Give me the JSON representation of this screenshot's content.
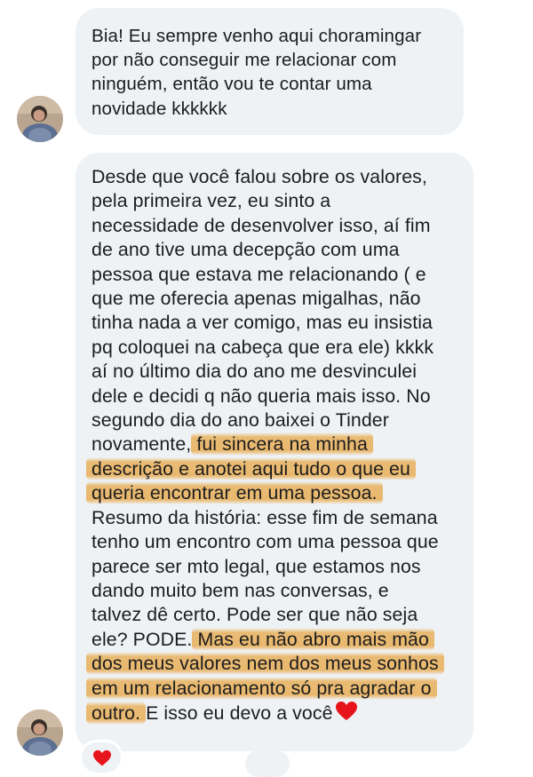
{
  "messages": [
    {
      "lines": [
        "Bia! Eu sempre venho aqui choramingar",
        "por não conseguir me relacionar com",
        "ninguém, então vou te contar uma",
        "novidade kkkkkk"
      ]
    },
    {
      "lines": [
        "Desde que você falou sobre os valores,",
        "pela primeira vez, eu sinto a",
        "necessidade de desenvolver isso, aí fim",
        "de ano tive uma decepção com uma",
        "pessoa que estava me relacionando ( e",
        "que me oferecia apenas migalhas, não",
        "tinha nada a ver comigo, mas eu insistia",
        "pq coloquei na cabeça que era ele) kkkk",
        "aí no último dia do ano me desvinculei",
        "dele e decidi q não queria mais isso. No",
        "segundo dia do ano baixei o Tinder"
      ],
      "line12_plain": "novamente, ",
      "line12_highlight": "fui sincera na minha",
      "line13_highlight": "descrição e anotei aqui tudo o que eu",
      "line14_highlight": "queria encontrar em uma pessoa.",
      "lines_after": [
        "Resumo da história: esse fim de semana",
        "tenho um encontro com uma pessoa que",
        "parece ser mto legal, que estamos nos",
        "dando muito bem nas conversas, e",
        "talvez dê certo. Pode ser que não seja"
      ],
      "line20_plain": "ele? PODE. ",
      "line20_highlight": "Mas eu não abro mais mão",
      "line21_highlight": "dos meus valores nem dos meus sonhos",
      "line22_highlight": "em um relacionamento só pra agradar o",
      "line23_highlight": "outro.",
      "line23_plain": " E isso eu devo a você",
      "inline_emoji": "red-heart"
    }
  ],
  "reaction": {
    "emoji": "red-heart"
  },
  "colors": {
    "bubble": "#eff2f5",
    "highlight": "#e7a848",
    "heart": "#e8141c"
  }
}
